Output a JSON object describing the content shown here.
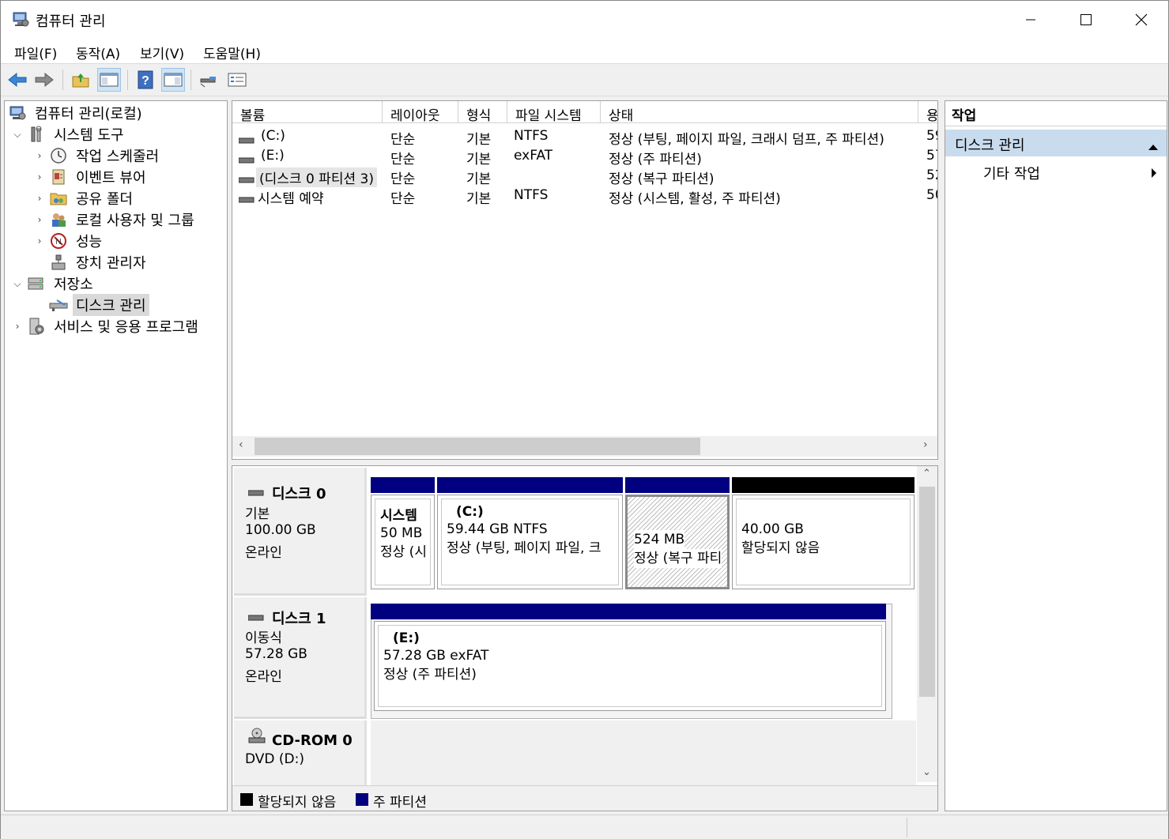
{
  "window": {
    "title": "컴퓨터 관리",
    "icon": "computer-management-icon"
  },
  "menu": [
    "파일(F)",
    "동작(A)",
    "보기(V)",
    "도움말(H)"
  ],
  "toolbar": {
    "buttons": [
      "back-icon",
      "forward-icon",
      "up-folder-icon",
      "show-hide-console-tree-icon",
      "help-icon",
      "show-hide-action-pane-icon",
      "connect-icon",
      "properties-icon"
    ]
  },
  "tree": {
    "root": "컴퓨터 관리(로컬)",
    "system_tools": "시스템 도구",
    "task_scheduler": "작업 스케줄러",
    "event_viewer": "이벤트 뷰어",
    "shared_folders": "공유 폴더",
    "local_users": "로컬 사용자 및 그룹",
    "performance": "성능",
    "device_manager": "장치 관리자",
    "storage": "저장소",
    "disk_management": "디스크 관리",
    "services": "서비스 및 응용 프로그램"
  },
  "volume_list": {
    "columns": [
      "볼륨",
      "레이아웃",
      "형식",
      "파일 시스템",
      "상태",
      "용"
    ],
    "rows": [
      {
        "volume": "(C:)",
        "layout": "단순",
        "type": "기본",
        "fs": "NTFS",
        "status": "정상 (부팅, 페이지 파일, 크래시 덤프, 주 파티션)",
        "cap": "59"
      },
      {
        "volume": "(E:)",
        "layout": "단순",
        "type": "기본",
        "fs": "exFAT",
        "status": "정상 (주 파티션)",
        "cap": "57"
      },
      {
        "volume": "(디스크 0 파티션 3)",
        "layout": "단순",
        "type": "기본",
        "fs": "",
        "status": "정상 (복구 파티션)",
        "cap": "52"
      },
      {
        "volume": "시스템 예약",
        "layout": "단순",
        "type": "기본",
        "fs": "NTFS",
        "status": "정상 (시스템, 활성, 주 파티션)",
        "cap": "50"
      }
    ]
  },
  "disks": {
    "disk0": {
      "name": "디스크 0",
      "kind": "기본",
      "size": "100.00 GB",
      "state": "온라인",
      "partitions": [
        {
          "name": "시스템",
          "size": "50 MB",
          "status": "정상 (시"
        },
        {
          "name": "(C:)",
          "size": "59.44 GB NTFS",
          "status": "정상 (부팅, 페이지 파일, 크"
        },
        {
          "name": "",
          "size": "524 MB",
          "status": "정상 (복구 파티"
        },
        {
          "name": "",
          "size": "40.00 GB",
          "status": "할당되지 않음"
        }
      ]
    },
    "disk1": {
      "name": "디스크 1",
      "kind": "이동식",
      "size": "57.28 GB",
      "state": "온라인",
      "partitions": [
        {
          "name": "(E:)",
          "size": "57.28 GB exFAT",
          "status": "정상 (주 파티션)"
        }
      ]
    },
    "cdrom0": {
      "name": "CD-ROM 0",
      "kind": "DVD (D:)"
    }
  },
  "legend": {
    "unallocated": "할당되지 않음",
    "primary": "주 파티션"
  },
  "colors": {
    "primary_partition": "#000080",
    "unallocated": "#000000",
    "action_group_bg": "#c9dcee"
  },
  "actions": {
    "header": "작업",
    "group": "디스크 관리",
    "item": "기타 작업"
  }
}
